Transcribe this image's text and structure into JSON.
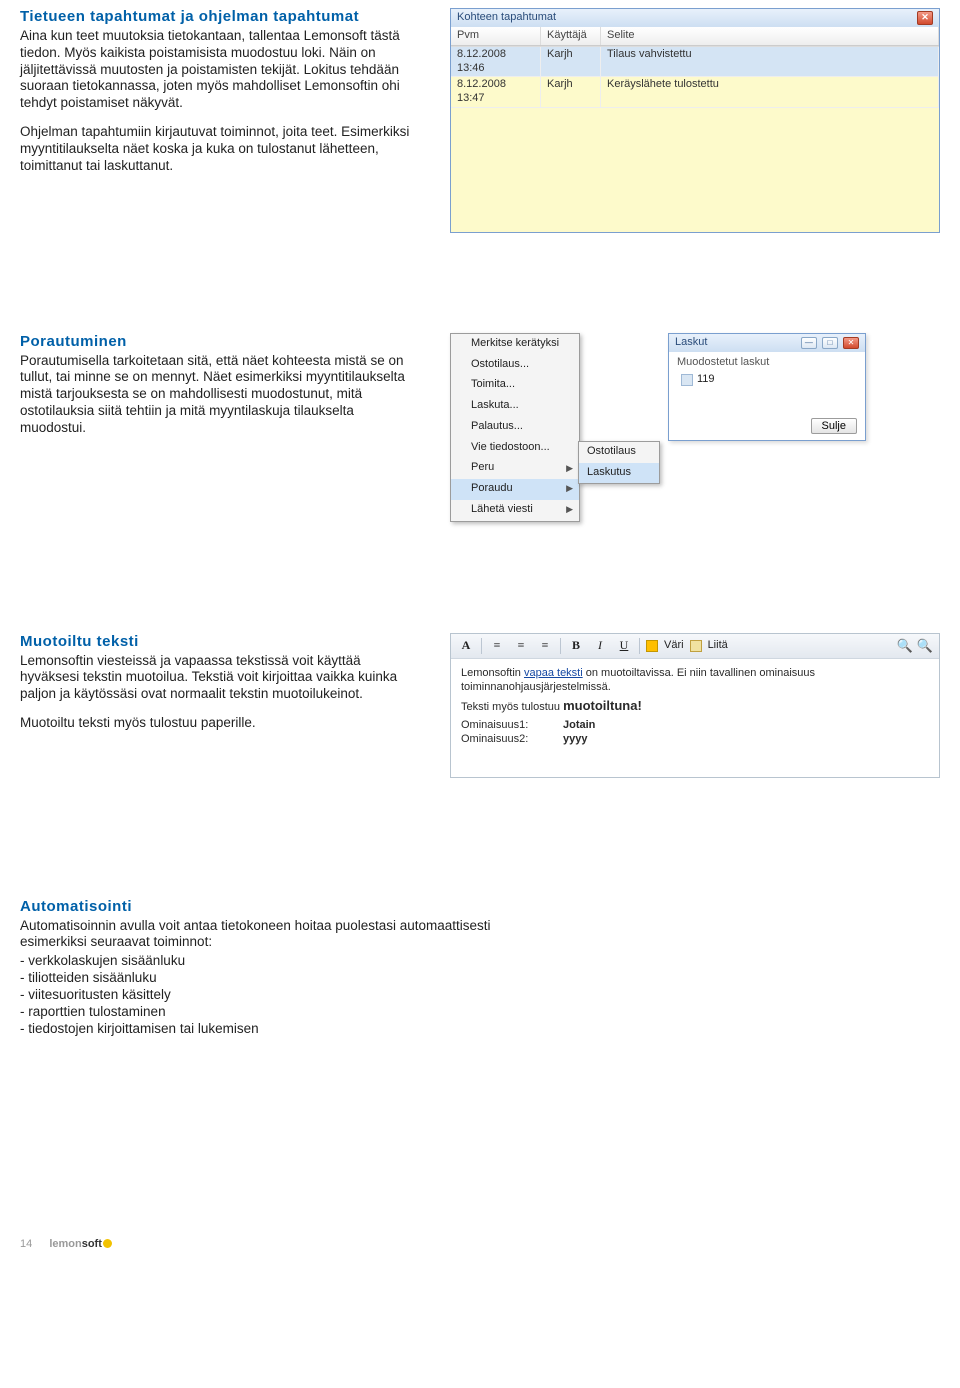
{
  "s1": {
    "heading": "Tietueen tapahtumat ja ohjelman tapahtumat",
    "p1": "Aina kun teet muutoksia tietokantaan, tallentaa Lemonsoft tästä tiedon. Myös kaikista poistamisista muodostuu loki. Näin on jäljitettävissä muutosten ja poistamisten tekijät. Lokitus tehdään suoraan tietokannassa, joten myös mahdolliset Lemonsoftin ohi tehdyt poistamiset näkyvät.",
    "p2": "Ohjelman tapahtumiin kirjautuvat toiminnot, joita teet. Esimerkiksi myyntitilaukselta näet koska ja kuka on tulostanut lähetteen, toimittanut tai laskuttanut."
  },
  "events": {
    "title": "Kohteen tapahtumat",
    "headers": {
      "pvm": "Pvm",
      "kayttaja": "Käyttäjä",
      "selite": "Selite"
    },
    "rows": [
      {
        "pvm": "8.12.2008 13:46",
        "kay": "Karjh",
        "sel": "Tilaus vahvistettu"
      },
      {
        "pvm": "8.12.2008 13:47",
        "kay": "Karjh",
        "sel": "Keräyslähete tulostettu"
      }
    ]
  },
  "s2": {
    "heading": "Porautuminen",
    "p1": "Porautumisella tarkoitetaan sitä, että näet kohteesta mistä se on tullut, tai minne se on mennyt. Näet esimerkiksi myyntitilaukselta mistä tarjouksesta se on mahdollisesti muodostunut, mitä ostotilauksia siitä tehtiin ja mitä myyntilaskuja tilaukselta muodostui."
  },
  "ctx": {
    "items": [
      "Merkitse kerätyksi",
      "Ostotilaus...",
      "Toimita...",
      "Laskuta...",
      "Palautus...",
      "Vie tiedostoon...",
      "Peru"
    ],
    "poraudu": "Poraudu",
    "laheta": "Lähetä viesti",
    "sub": [
      "Ostotilaus",
      "Laskutus"
    ]
  },
  "laskut": {
    "title": "Laskut",
    "header": "Muodostetut laskut",
    "item": "119",
    "close": "Sulje"
  },
  "s3": {
    "heading": "Muotoiltu teksti",
    "p1": "Lemonsoftin viesteissä ja vapaassa tekstissä voit käyttää hyväksesi tekstin muotoilua. Tekstiä voit kirjoittaa vaikka kuinka paljon ja käytössäsi ovat normaalit tekstin muotoilukeinot.",
    "p2": "Muotoiltu teksti myös tulostuu paperille."
  },
  "rte": {
    "vari": "Väri",
    "liita": "Liitä",
    "line1a": "Lemonsoftin ",
    "line1b": "vapaa teksti",
    "line1c": " on muotoiltavissa. Ei niin tavallinen ominaisuus toiminnanohjausjärjestelmissä.",
    "line2a": "Teksti myös tulostuu ",
    "line2b": "muotoiltuna!",
    "k1": "Ominaisuus1:",
    "v1": "Jotain",
    "k2": "Ominaisuus2:",
    "v2": "yyyy"
  },
  "s4": {
    "heading": "Automatisointi",
    "p1": "Automatisoinnin avulla voit antaa tietokoneen hoitaa puolestasi automaattisesti esimerkiksi seuraavat toiminnot:",
    "b1": "- verkkolaskujen sisäänluku",
    "b2": "- tiliotteiden sisäänluku",
    "b3": "- viitesuoritusten käsittely",
    "b4": "- raporttien tulostaminen",
    "b5": "- tiedostojen kirjoittamisen tai lukemisen"
  },
  "footer": {
    "page": "14",
    "logo1": "lemon",
    "logo2": "soft"
  }
}
